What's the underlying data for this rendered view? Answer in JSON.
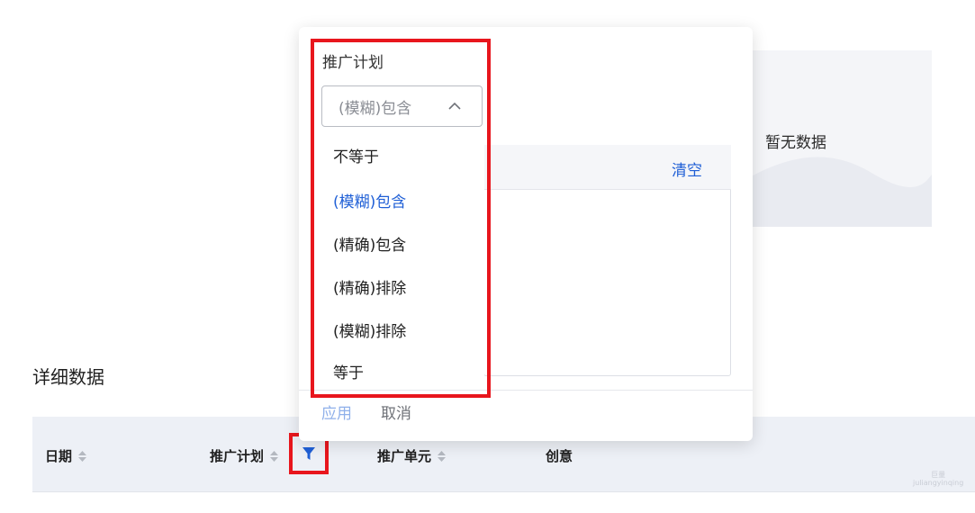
{
  "empty_state": {
    "text": "暂无数据"
  },
  "section": {
    "title": "详细数据"
  },
  "table": {
    "columns": [
      {
        "label": "日期",
        "sortable": true
      },
      {
        "label": "推广计划",
        "sortable": true,
        "filter": true
      },
      {
        "label": "推广单元",
        "sortable": true
      },
      {
        "label": "创意",
        "sortable": false
      }
    ]
  },
  "filter_popover": {
    "field_label": "推广计划",
    "select_value": "(模糊)包含",
    "clear_label": "清空",
    "options": [
      "不等于",
      "(模糊)包含",
      "(精确)包含",
      "(精确)排除",
      "(模糊)排除",
      "等于"
    ],
    "active_option": "(模糊)包含",
    "apply_label": "应用",
    "cancel_label": "取消"
  },
  "colors": {
    "accent": "#1f5fd6",
    "highlight": "#e8161d",
    "header_bg": "#edf0f6"
  },
  "watermark": {
    "line1": "巨量",
    "line2": "juliangyinqing"
  }
}
